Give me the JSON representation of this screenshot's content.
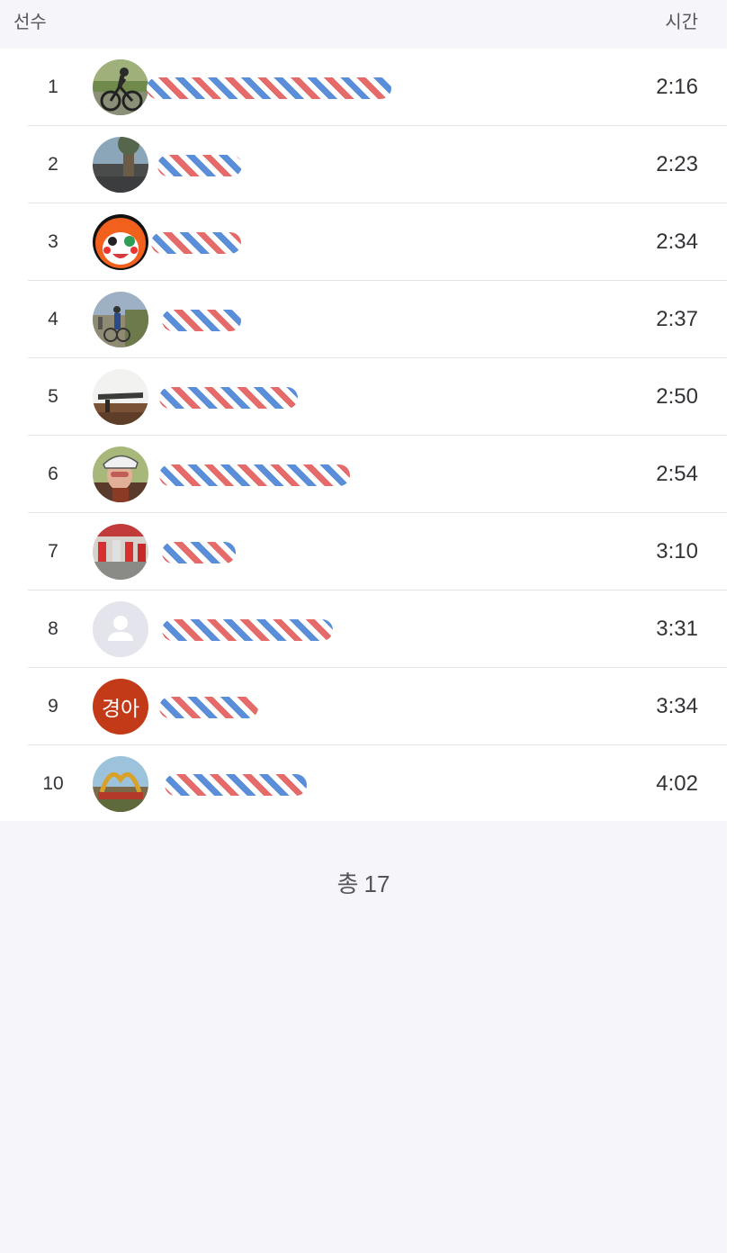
{
  "header": {
    "player_label": "선수",
    "time_label": "시간"
  },
  "rows": [
    {
      "rank": "1",
      "time": "2:16",
      "avatar_icon": "cyclist-photo-avatar"
    },
    {
      "rank": "2",
      "time": "2:23",
      "avatar_icon": "landscape-photo-avatar"
    },
    {
      "rank": "3",
      "time": "2:34",
      "avatar_icon": "cartoon-character-avatar"
    },
    {
      "rank": "4",
      "time": "2:37",
      "avatar_icon": "cycling-group-photo-avatar"
    },
    {
      "rank": "5",
      "time": "2:50",
      "avatar_icon": "coast-photo-avatar"
    },
    {
      "rank": "6",
      "time": "2:54",
      "avatar_icon": "helmet-selfie-avatar"
    },
    {
      "rank": "7",
      "time": "3:10",
      "avatar_icon": "crowd-photo-avatar"
    },
    {
      "rank": "8",
      "time": "3:31",
      "avatar_icon": "default-person-icon"
    },
    {
      "rank": "9",
      "time": "3:34",
      "avatar_text": "경아",
      "avatar_icon": "initials-avatar"
    },
    {
      "rank": "10",
      "time": "4:02",
      "avatar_icon": "arch-photo-avatar"
    }
  ],
  "footer": {
    "total_label": "총",
    "total_count": "17"
  },
  "colors": {
    "panel_background": "#f5f5fa",
    "initials_avatar_background": "#c23a17",
    "default_avatar_background": "#e4e4ec",
    "redaction_red": "#e56a6a",
    "redaction_blue": "#5b8ed8"
  }
}
